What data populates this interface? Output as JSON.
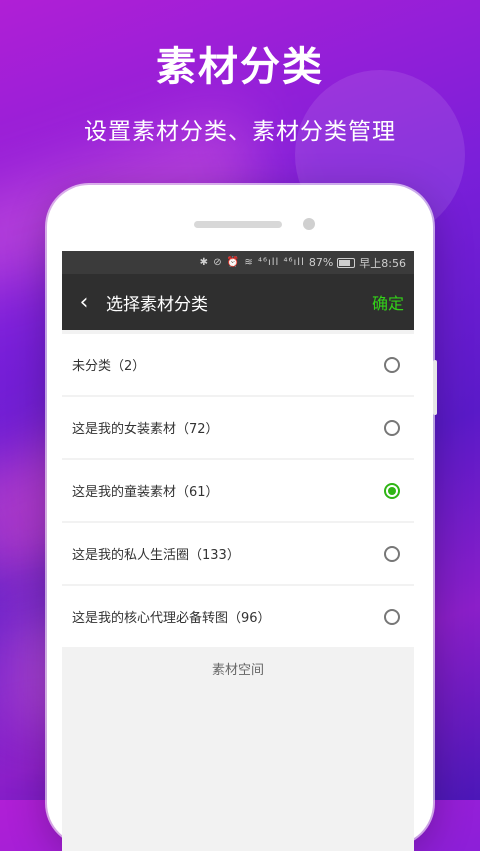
{
  "banner": {
    "title": "素材分类",
    "subtitle": "设置素材分类、素材分类管理"
  },
  "status_bar": {
    "icons": "✱ ⊘ ⏰ ≋ ⁴⁶ıll ⁴⁶ıll",
    "battery_percent": "87%",
    "time": "早上8:56"
  },
  "app_bar": {
    "title": "选择素材分类",
    "confirm_label": "确定"
  },
  "categories": [
    {
      "label": "未分类（2）",
      "selected": false
    },
    {
      "label": "这是我的女装素材（72）",
      "selected": false
    },
    {
      "label": "这是我的童装素材（61）",
      "selected": true
    },
    {
      "label": "这是我的私人生活圈（133）",
      "selected": false
    },
    {
      "label": "这是我的核心代理必备转图（96）",
      "selected": false
    }
  ],
  "footer": {
    "label": "素材空间"
  },
  "colors": {
    "accent_green": "#2fb515",
    "confirm_green": "#33d119",
    "app_bar": "#2f2f2f"
  }
}
